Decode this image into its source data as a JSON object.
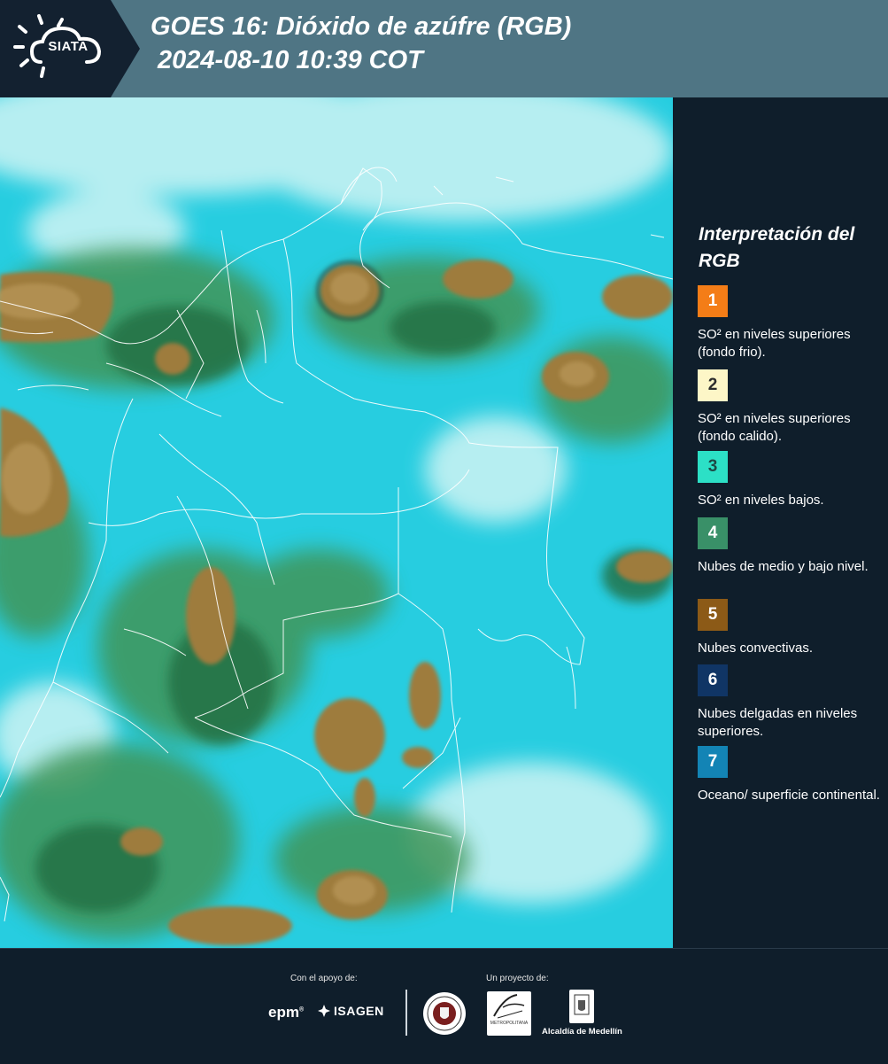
{
  "header": {
    "logo_text": "SIATA",
    "title": "GOES 16: Dióxido de azúfre (RGB)",
    "datetime": "2024-08-10 10:39 COT"
  },
  "map": {
    "palette": {
      "cyan_background": "#26cfe0",
      "pale_haze": "#c4f1f1",
      "green_cloud": "#3e9258",
      "dark_green_cloud": "#1e6a40",
      "convective_brown": "#9c7a3c",
      "convective_light": "#b8955a",
      "border_line": "#ffffff"
    }
  },
  "legend": {
    "title": "Interpretación del RGB",
    "items": [
      {
        "number": "1",
        "color": "#f47d17",
        "text_color": "#ffffff",
        "description": "SO² en niveles superiores (fondo frio)."
      },
      {
        "number": "2",
        "color": "#fdf6c7",
        "text_color": "#2c2c2c",
        "description": "SO² en niveles superiores (fondo calido)."
      },
      {
        "number": "3",
        "color": "#2ce0c6",
        "text_color": "#1d4a46",
        "description": "SO² en niveles bajos."
      },
      {
        "number": "4",
        "color": "#399068",
        "text_color": "#ffffff",
        "description": "Nubes de medio y bajo nivel."
      },
      {
        "number": "5",
        "color": "#8c5a17",
        "text_color": "#ffffff",
        "description": "Nubes convectivas."
      },
      {
        "number": "6",
        "color": "#103565",
        "text_color": "#ffffff",
        "description": "Nubes delgadas en niveles superiores."
      },
      {
        "number": "7",
        "color": "#1384b5",
        "text_color": "#ffffff",
        "description": "Oceano/ superficie continental."
      }
    ]
  },
  "footer": {
    "support_label": "Con el apoyo de:",
    "project_label": "Un proyecto de:",
    "sponsors": [
      "epm",
      "ISAGEN"
    ],
    "partners": [
      "Área Metropolitana Valle de Aburrá",
      "Alcaldía de Medellín"
    ],
    "area_logo_text": "METROPOLITANA"
  }
}
